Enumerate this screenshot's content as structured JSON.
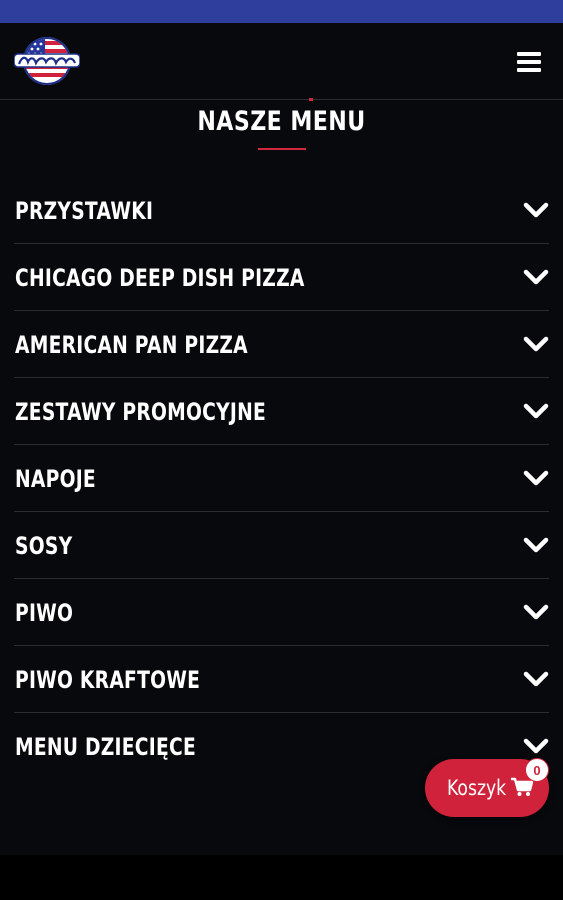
{
  "header": {
    "logo_icon": "pizza-brand-logo",
    "menu_icon": "hamburger-icon"
  },
  "section": {
    "title": "NASZE MENU",
    "accent_color": "#d0283c"
  },
  "menu": {
    "items": [
      {
        "label": "PRZYSTAWKI"
      },
      {
        "label": "CHICAGO DEEP DISH PIZZA"
      },
      {
        "label": "AMERICAN PAN PIZZA"
      },
      {
        "label": "ZESTAWY PROMOCYJNE"
      },
      {
        "label": "NAPOJE"
      },
      {
        "label": "SOSY"
      },
      {
        "label": "PIWO"
      },
      {
        "label": "PIWO KRAFTOWE"
      },
      {
        "label": "MENU DZIECIĘCE"
      }
    ],
    "expand_icon": "chevron-down-icon"
  },
  "cart": {
    "label": "Koszyk",
    "count": "0",
    "icon": "cart-icon",
    "color": "#d0233b"
  },
  "colors": {
    "status_bar": "#2f3d9c",
    "background": "#08090d"
  }
}
